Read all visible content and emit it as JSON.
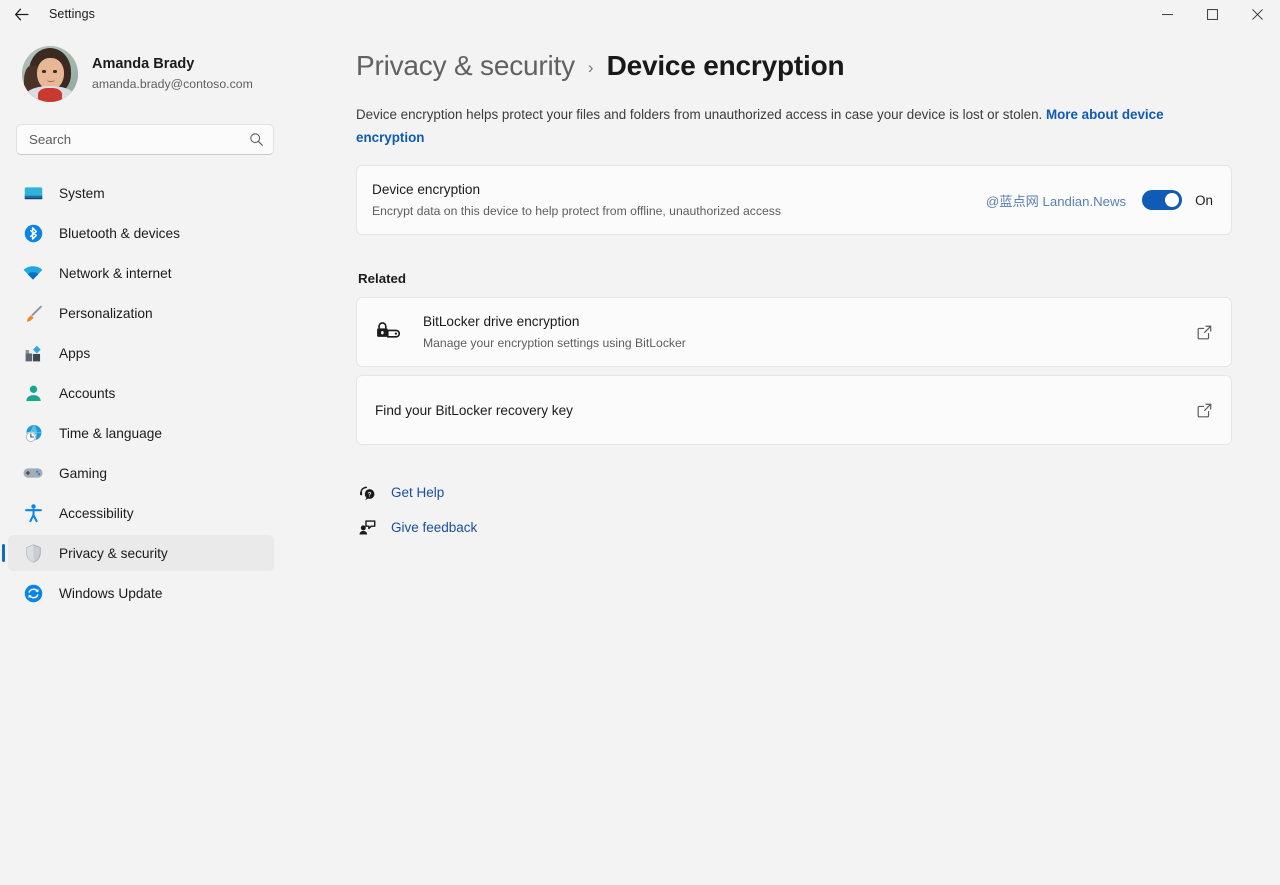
{
  "titlebar": {
    "back_label": "back-arrow",
    "app_title": "Settings",
    "minimize": "─",
    "maximize": "□",
    "close": "✕"
  },
  "sidebar": {
    "profile": {
      "name": "Amanda Brady",
      "email": "amanda.brady@contoso.com",
      "avatar_alt": "user-avatar"
    },
    "search": {
      "placeholder": "Search",
      "value": "",
      "icon": "search-icon"
    },
    "items": [
      {
        "label": "System",
        "icon": "monitor-icon",
        "selected": false
      },
      {
        "label": "Bluetooth & devices",
        "icon": "bluetooth-icon",
        "selected": false
      },
      {
        "label": "Network & internet",
        "icon": "wifi-icon",
        "selected": false
      },
      {
        "label": "Personalization",
        "icon": "paintbrush-icon",
        "selected": false
      },
      {
        "label": "Apps",
        "icon": "apps-icon",
        "selected": false
      },
      {
        "label": "Accounts",
        "icon": "person-icon",
        "selected": false
      },
      {
        "label": "Time & language",
        "icon": "globe-clock-icon",
        "selected": false
      },
      {
        "label": "Gaming",
        "icon": "gamepad-icon",
        "selected": false
      },
      {
        "label": "Accessibility",
        "icon": "accessibility-icon",
        "selected": false
      },
      {
        "label": "Privacy & security",
        "icon": "shield-icon",
        "selected": true
      },
      {
        "label": "Windows Update",
        "icon": "update-icon",
        "selected": false
      }
    ]
  },
  "main": {
    "breadcrumb": {
      "parent": "Privacy & security",
      "separator": "›",
      "current": "Device encryption"
    },
    "intro": {
      "text": "Device encryption helps protect your files and folders from unauthorized access in case your device is lost or stolen. ",
      "link": "More about device encryption"
    },
    "encryption_card": {
      "title": "Device encryption",
      "subtitle": "Encrypt data on this device to help protect from offline, unauthorized access",
      "watermark": "@蓝点网 Landian.News",
      "toggle_state": "On",
      "toggle_on": true
    },
    "related": {
      "heading": "Related",
      "items": [
        {
          "title": "BitLocker drive encryption",
          "subtitle": "Manage your encryption settings using BitLocker",
          "icon": "lock-drive-icon",
          "action_icon": "external-link-icon"
        },
        {
          "title": "Find your BitLocker recovery key",
          "subtitle": "",
          "icon": "",
          "action_icon": "external-link-icon"
        }
      ]
    },
    "footer_links": [
      {
        "label": "Get Help",
        "icon": "help-headset-icon"
      },
      {
        "label": "Give feedback",
        "icon": "feedback-person-icon"
      }
    ]
  },
  "colors": {
    "page_bg": "#F3F3F3",
    "card_bg": "#FBFBFB",
    "accent": "#0F5BB5",
    "link": "#1A4FA0",
    "selected_pill": "#EAEAEA",
    "watermark": "#5A7FB5"
  }
}
